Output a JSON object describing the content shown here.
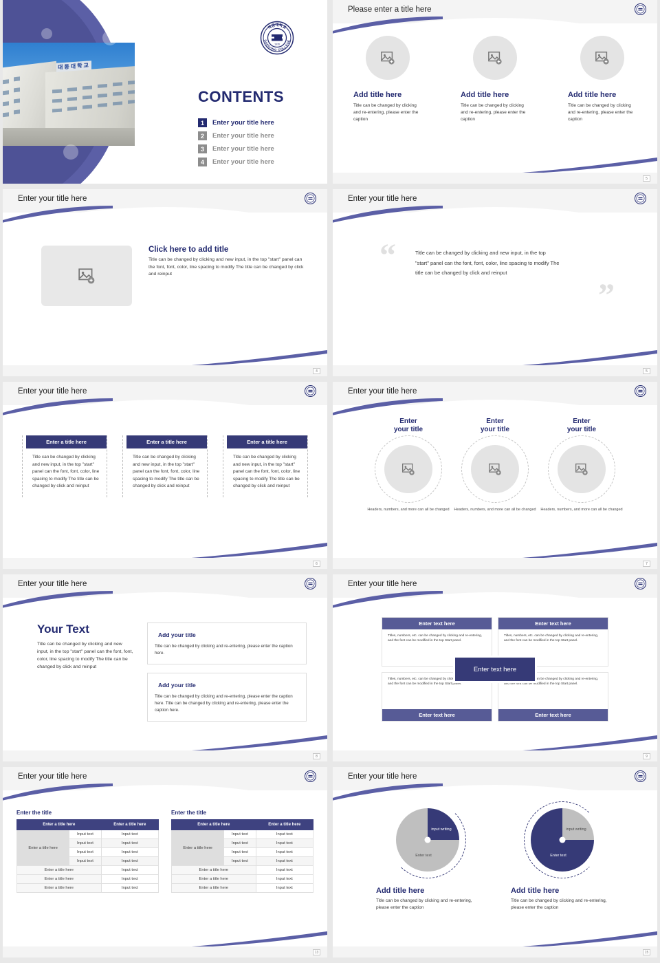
{
  "brand": {
    "accent_navy": "#232a70",
    "accent_indigo": "#363a77",
    "accent_purple": "#5b5fa6",
    "logo_text_top": "대동대학교",
    "logo_text_bottom": "DAEDONG COLLEGE",
    "logo_year": "1978"
  },
  "slides": [
    {
      "kind": "title",
      "contents_heading": "CONTENTS",
      "items": [
        {
          "num": "1",
          "label": "Enter your title here"
        },
        {
          "num": "2",
          "label": "Enter your title here"
        },
        {
          "num": "3",
          "label": "Enter your title here"
        },
        {
          "num": "4",
          "label": "Enter your title here"
        }
      ]
    },
    {
      "kind": "three-circles",
      "title": "Please enter a title here",
      "page": "5",
      "columns": [
        {
          "heading": "Add title here",
          "caption": "Title can be changed by clicking and re-entering, please enter the caption"
        },
        {
          "heading": "Add title here",
          "caption": "Title can be changed by clicking and re-entering, please enter the caption"
        },
        {
          "heading": "Add title here",
          "caption": "Title can be changed by clicking and re-entering, please enter the caption"
        }
      ]
    },
    {
      "kind": "image-text",
      "title": "Enter your title here",
      "page": "4",
      "heading": "Click here to add title",
      "body": "Title can be changed by clicking and new input, in the top \"start\" panel can the font, font, color, line spacing to modify The title can be changed by click and reinput"
    },
    {
      "kind": "quote",
      "title": "Enter your title here",
      "page": "5",
      "quote": "Title can be changed by clicking and new input, in the top \"start\" panel can the font, font, color, line spacing to modify The title can be changed by click and reinput",
      "open_mark": "“",
      "close_mark": "”"
    },
    {
      "kind": "three-bars",
      "title": "Enter your title here",
      "page": "6",
      "columns": [
        {
          "bar": "Enter a title here",
          "body": "Title can be changed by clicking and new input, in the top \"start\" panel can the font, font, color, line spacing to modify The title can be changed by click and reinput"
        },
        {
          "bar": "Enter a title here",
          "body": "Title can be changed by clicking and new input, in the top \"start\" panel can the font, font, color, line spacing to modify The title can be changed by click and reinput"
        },
        {
          "bar": "Enter a title here",
          "body": "Title can be changed by clicking and new input, in the top \"start\" panel can the font, font, color, line spacing to modify The title can be changed by click and reinput"
        }
      ]
    },
    {
      "kind": "three-rings",
      "title": "Enter your title here",
      "page": "7",
      "columns": [
        {
          "heading_line1": "Enter",
          "heading_line2": "your title",
          "caption": "Headers, numbers, and more can all be changed"
        },
        {
          "heading_line1": "Enter",
          "heading_line2": "your title",
          "caption": "Headers, numbers, and more can all be changed"
        },
        {
          "heading_line1": "Enter",
          "heading_line2": "your title",
          "caption": "Headers, numbers, and more can all be changed"
        }
      ]
    },
    {
      "kind": "your-text",
      "title": "Enter your title here",
      "page": "8",
      "big_heading": "Your Text",
      "big_body": "Title can be changed by clicking and new input, in the top \"start\" panel can the font, font, color, line spacing to modify The title can be changed by click and reinput",
      "boxes": [
        {
          "heading": "Add your title",
          "body": "Title can be changed by clicking and re-entering, please enter the caption here."
        },
        {
          "heading": "Add your title",
          "body": "Title can be changed by clicking and re-entering, please enter the caption here. Title can be changed by clicking and re-entering, please enter the caption here."
        }
      ]
    },
    {
      "kind": "quad-grid",
      "title": "Enter your title here",
      "page": "9",
      "center_label": "Enter text here",
      "cells": [
        {
          "bar": "Enter text here",
          "body": "Titles, numbers, etc. can be changed by clicking and re-entering, and the font can be modified in the top Start panel."
        },
        {
          "bar": "Enter text here",
          "body": "Titles, numbers, etc. can be changed by clicking and re-entering, and the font can be modified in the top Start panel."
        },
        {
          "bar": "Enter text here",
          "body": "Titles, numbers, etc. can be changed by clicking and re-entering, and the font can be modified in the top Start panel."
        },
        {
          "bar": "Enter text here",
          "body": "Titles, numbers, etc. can be changed by clicking and re-entering, and the font can be modified in the top Start panel."
        }
      ]
    },
    {
      "kind": "tables",
      "title": "Enter your title here",
      "page": "13",
      "tables": [
        {
          "caption": "Enter the title",
          "headers": [
            "Enter a title here",
            "Enter a title here"
          ],
          "row_label": "Enter a title here",
          "grouped_rows": [
            [
              "Input text",
              "Input text"
            ],
            [
              "Input text",
              "Input text"
            ],
            [
              "Input text",
              "Input text"
            ],
            [
              "Input text",
              "Input text"
            ]
          ],
          "flat_rows": [
            [
              "Enter a title here",
              "Input text"
            ],
            [
              "Enter a title here",
              "Input text"
            ],
            [
              "Enter a title here",
              "Input text"
            ]
          ]
        },
        {
          "caption": "Enter the title",
          "headers": [
            "Enter a title here",
            "Enter a title here"
          ],
          "row_label": "Enter a title here",
          "grouped_rows": [
            [
              "Input text",
              "Input text"
            ],
            [
              "Input text",
              "Input text"
            ],
            [
              "Input text",
              "Input text"
            ],
            [
              "Input text",
              "Input text"
            ]
          ],
          "flat_rows": [
            [
              "Enter a title here",
              "Input text"
            ],
            [
              "Enter a title here",
              "Input text"
            ],
            [
              "Enter a title here",
              "Input text"
            ]
          ]
        }
      ]
    },
    {
      "kind": "pies",
      "title": "Enter your title here",
      "page": "15",
      "charts": [
        {
          "slice_label": "input writing",
          "rest_label": "Enter text",
          "heading": "Add title here",
          "caption": "Title can be changed by clicking and re-entering, please enter the caption"
        },
        {
          "slice_label": "input writing",
          "rest_label": "Enter text",
          "heading": "Add title here",
          "caption": "Title can be changed by clicking and re-entering, please enter the caption"
        }
      ]
    }
  ],
  "chart_data": [
    {
      "type": "pie",
      "title": "Add title here",
      "labels": [
        "input writing",
        "Enter text"
      ],
      "values": [
        25,
        75
      ],
      "colors": [
        "#363a77",
        "#bfbfbf"
      ],
      "start_angle": 0,
      "legend": "none"
    },
    {
      "type": "pie",
      "title": "Add title here",
      "labels": [
        "input writing",
        "Enter text"
      ],
      "values": [
        25,
        75
      ],
      "colors": [
        "#bfbfbf",
        "#363a77"
      ],
      "start_angle": 0,
      "legend": "none"
    }
  ]
}
